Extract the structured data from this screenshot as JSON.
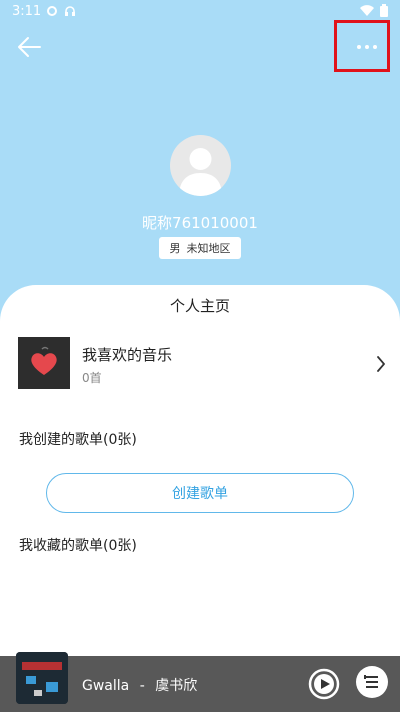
{
  "status_bar": {
    "time": "3:11"
  },
  "profile": {
    "nickname": "昵称761010001",
    "gender": "男",
    "region": "未知地区"
  },
  "card": {
    "title": "个人主页",
    "favorite": {
      "title": "我喜欢的音乐",
      "count": "0首"
    },
    "created_section": "我创建的歌单(0张)",
    "create_button": "创建歌单",
    "collected_section": "我收藏的歌单(0张)"
  },
  "player": {
    "song": "Gwalla",
    "separator": "-",
    "artist": "虞书欣"
  },
  "colors": {
    "header_bg": "#a9dcf7",
    "accent": "#35a3e2",
    "highlight_box": "#e0121a",
    "player_bg": "#585858"
  }
}
